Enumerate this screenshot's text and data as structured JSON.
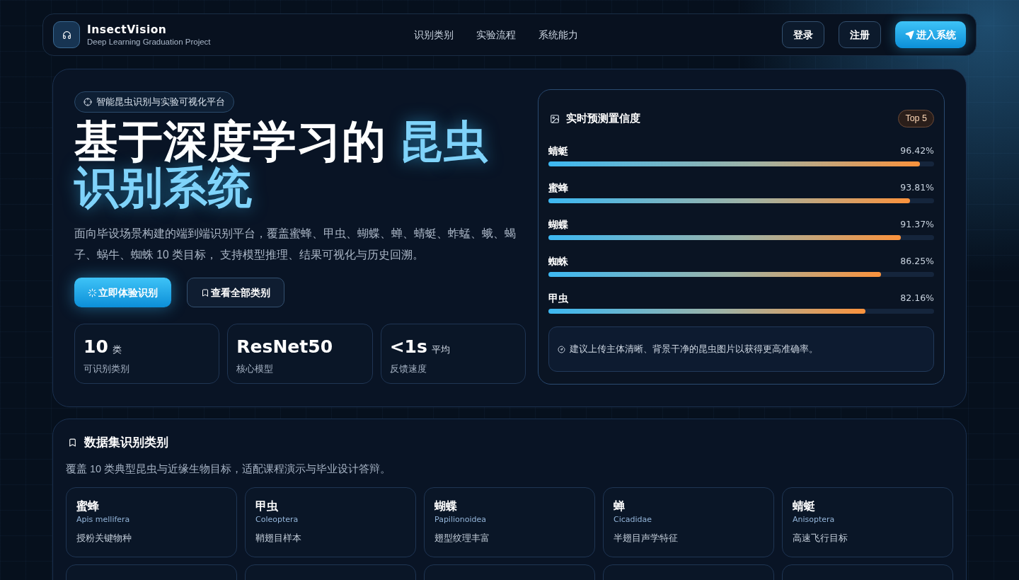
{
  "nav": {
    "brand": {
      "name": "InsectVision",
      "tagline": "Deep Learning Graduation Project"
    },
    "links": [
      "识别类别",
      "实验流程",
      "系统能力"
    ],
    "buttons": [
      {
        "label": "登录",
        "kind": "outline"
      },
      {
        "label": "注册",
        "kind": "outline"
      },
      {
        "label": "进入系统",
        "kind": "primary"
      }
    ]
  },
  "hero": {
    "badge": "智能昆虫识别与实验可视化平台",
    "title": "基于深度学习的 ",
    "title_highlight": "昆虫识别系统",
    "description": "面向毕设场景构建的端到端识别平台，覆盖蜜蜂、甲虫、蝴蝶、蝉、蜻蜓、蚱蜢、蛾、蝎子、蜗牛、蜘蛛 10 类目标， 支持模型推理、结果可视化与历史回溯。",
    "buttons": [
      {
        "label": "立即体验识别",
        "kind": "primary"
      },
      {
        "label": "查看全部类别",
        "kind": "secondary"
      }
    ],
    "stats": [
      {
        "value": "10",
        "unit": "类",
        "label": "可识别类别"
      },
      {
        "value": "ResNet50",
        "label": "核心模型"
      },
      {
        "value": "<1s",
        "unit": "平均",
        "label": "反馈速度"
      }
    ]
  },
  "confidence_panel": {
    "title": "实时预测置信度",
    "badge": "Top 5",
    "predictions": [
      {
        "name": "蜻蜓",
        "reading": "96.42%",
        "level": 0.9642
      },
      {
        "name": "蜜蜂",
        "reading": "93.81%",
        "level": 0.9381
      },
      {
        "name": "蝴蝶",
        "reading": "91.37%",
        "level": 0.9137
      },
      {
        "name": "蜘蛛",
        "reading": "86.25%",
        "level": 0.8625
      },
      {
        "name": "甲虫",
        "reading": "82.16%",
        "level": 0.8216
      }
    ],
    "tip": "建议上传主体清晰、背景干净的昆虫图片以获得更高准确率。"
  },
  "categories": {
    "title": "数据集识别类别",
    "description": "覆盖 10 类典型昆虫与近缘生物目标，适配课程演示与毕业设计答辩。",
    "items": [
      {
        "kind": "species",
        "name": "蜜蜂",
        "latin": "Apis mellifera",
        "note": "授粉关键物种"
      },
      {
        "kind": "species",
        "name": "甲虫",
        "latin": "Coleoptera",
        "note": "鞘翅目样本"
      },
      {
        "kind": "species",
        "name": "蝴蝶",
        "latin": "Papilionoidea",
        "note": "翅型纹理丰富"
      },
      {
        "kind": "species",
        "name": "蝉",
        "latin": "Cicadidae",
        "note": "半翅目声学特征"
      },
      {
        "kind": "species",
        "name": "蜻蜓",
        "latin": "Anisoptera",
        "note": "高速飞行目标"
      },
      {
        "kind": "clipped"
      },
      {
        "kind": "clipped"
      },
      {
        "kind": "clipped"
      },
      {
        "kind": "clipped"
      },
      {
        "kind": "clipped"
      }
    ]
  }
}
